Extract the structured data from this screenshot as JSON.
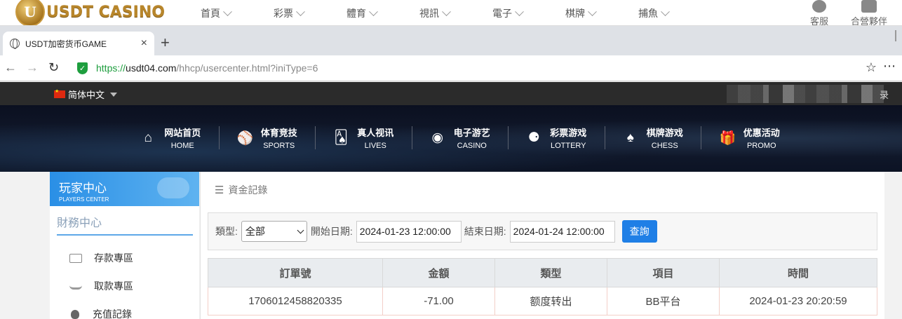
{
  "site_nav": {
    "logo_badge": "U",
    "logo_text": "USDT CASINO",
    "menu": [
      "首頁",
      "彩票",
      "體育",
      "視訊",
      "電子",
      "棋牌",
      "捕魚"
    ],
    "service_label": "客服",
    "partner_label": "合營夥伴"
  },
  "browser": {
    "tab_title": "USDT加密货币GAME",
    "tab_close": "×",
    "new_tab": "+",
    "url_scheme": "https://",
    "url_host": "usdt04.com",
    "url_path": "/hhcp/usercenter.html?iniType=6"
  },
  "header": {
    "language": "简体中文",
    "login_tail": "录"
  },
  "main_nav": [
    {
      "icon": "home-icon",
      "glyph": "⌂",
      "cn": "网站首页",
      "en": "HOME"
    },
    {
      "icon": "sports-ball-icon",
      "glyph": "⚾",
      "cn": "体育竞技",
      "en": "SPORTS"
    },
    {
      "icon": "cards-icon",
      "glyph": "🂡",
      "cn": "真人视讯",
      "en": "LIVES"
    },
    {
      "icon": "slot-icon",
      "glyph": "◉",
      "cn": "电子游艺",
      "en": "CASINO"
    },
    {
      "icon": "lottery-balls-icon",
      "glyph": "⚈",
      "cn": "彩票游戏",
      "en": "LOTTERY"
    },
    {
      "icon": "chess-spade-icon",
      "glyph": "♠",
      "cn": "棋牌游戏",
      "en": "CHESS"
    },
    {
      "icon": "gift-icon",
      "glyph": "🎁",
      "cn": "优惠活动",
      "en": "PROMO"
    }
  ],
  "sidebar": {
    "title_cn": "玩家中心",
    "title_en": "PLAYERS CENTER",
    "section": "財務中心",
    "items": [
      "存款專區",
      "取款專區",
      "充值記錄"
    ]
  },
  "content": {
    "breadcrumb": "資金記錄",
    "filter": {
      "type_label": "類型:",
      "type_value": "全部",
      "start_label": "開始日期:",
      "start_value": "2024-01-23 12:00:00",
      "end_label": "結束日期:",
      "end_value": "2024-01-24 12:00:00",
      "query_button": "查詢"
    },
    "table": {
      "headers": [
        "訂單號",
        "金額",
        "類型",
        "項目",
        "時間"
      ],
      "rows": [
        [
          "1706012458820335",
          "-71.00",
          "额度转出",
          "BB平台",
          "2024-01-23 20:20:59"
        ]
      ]
    }
  },
  "colors": {
    "accent_blue": "#1f7fe6",
    "secure_green": "#1e9e3e",
    "header_dark": "#2b2b2b",
    "logo_gold": "#b8862b"
  }
}
